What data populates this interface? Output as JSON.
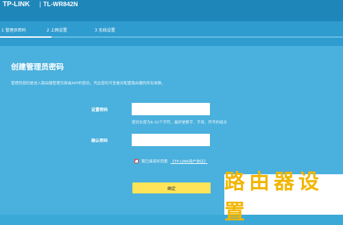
{
  "header": {
    "brand": "TP-LINK",
    "model": "TL-WR842N"
  },
  "steps": {
    "items": [
      {
        "label": "1 管理员密码"
      },
      {
        "label": "2 上网设置"
      },
      {
        "label": "3 无线设置"
      }
    ],
    "progress_fraction": 0.15
  },
  "page": {
    "title": "创建管理员密码",
    "description": "管理员密码是进入路由器管理页面或APP的密码，凭此密码可查看并配置路由器的所有参数。",
    "password_label": "设置密码",
    "password_hint": "密码长度为6-32个字符，最好是数字、字母、符号的组合",
    "confirm_label": "确认密码",
    "agree_text": "我已阅读并同意",
    "agree_link": "《TP-LINK用户协议》",
    "agree_checked": true,
    "confirm_button": "确定"
  },
  "watermark": {
    "text": "路由器设置"
  },
  "colors": {
    "header": "#1f86ba",
    "background": "#4ab0dd",
    "button": "#ffe45a",
    "watermark_text": "#f2b600"
  }
}
